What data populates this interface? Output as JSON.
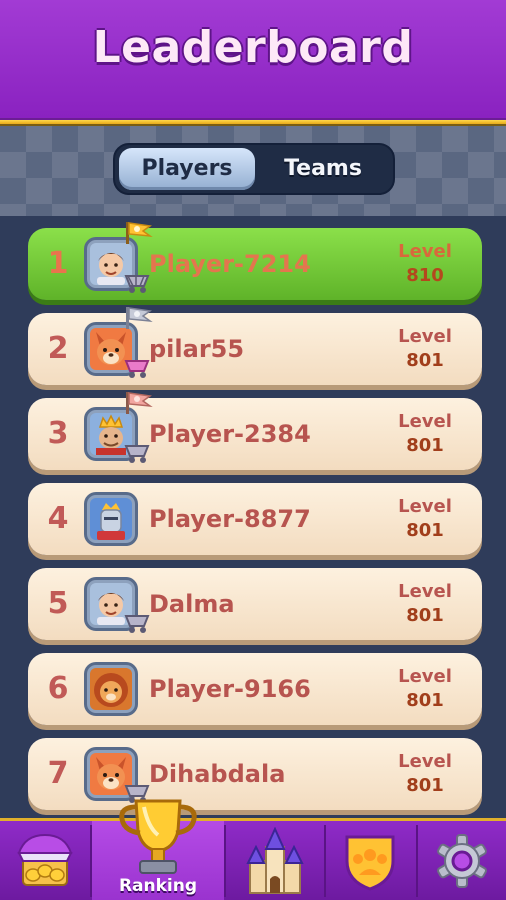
{
  "header": {
    "title": "Leaderboard"
  },
  "tabs": [
    {
      "label": "Players",
      "active": true
    },
    {
      "label": "Teams",
      "active": false
    }
  ],
  "level_label": "Level",
  "players": [
    {
      "rank": "1",
      "name": "Player-7214",
      "level": "810",
      "avatar": "boy-avatar",
      "highlight": true
    },
    {
      "rank": "2",
      "name": "pilar55",
      "level": "801",
      "avatar": "fox-avatar"
    },
    {
      "rank": "3",
      "name": "Player-2384",
      "level": "801",
      "avatar": "king-avatar"
    },
    {
      "rank": "4",
      "name": "Player-8877",
      "level": "801",
      "avatar": "knight-avatar"
    },
    {
      "rank": "5",
      "name": "Dalma",
      "level": "801",
      "avatar": "boy-avatar"
    },
    {
      "rank": "6",
      "name": "Player-9166",
      "level": "801",
      "avatar": "lion-avatar"
    },
    {
      "rank": "7",
      "name": "Dihabdala",
      "level": "801",
      "avatar": "fox-avatar"
    }
  ],
  "nav": {
    "items": [
      {
        "id": "shop",
        "icon": "shop-icon"
      },
      {
        "id": "ranking",
        "icon": "trophy-icon",
        "label": "Ranking",
        "selected": true
      },
      {
        "id": "castle",
        "icon": "castle-icon"
      },
      {
        "id": "team",
        "icon": "team-shield-icon"
      },
      {
        "id": "settings",
        "icon": "gear-icon"
      }
    ]
  },
  "colors": {
    "header": "#9a30cc",
    "highlight_row": "#6cc235",
    "row": "#f8e6cf",
    "rank_text": "#c15a57",
    "gold": "#e7a91a"
  }
}
